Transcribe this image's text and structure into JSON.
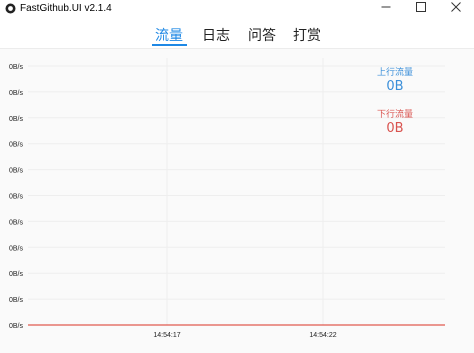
{
  "window": {
    "title": "FastGithub.UI v2.1.4"
  },
  "tabs": [
    {
      "label": "流量",
      "active": true
    },
    {
      "label": "日志",
      "active": false
    },
    {
      "label": "问答",
      "active": false
    },
    {
      "label": "打赏",
      "active": false
    }
  ],
  "stats": {
    "upload_label": "上行流量",
    "upload_value": "0B",
    "download_label": "下行流量",
    "download_value": "0B"
  },
  "colors": {
    "accent": "#1e88e5",
    "upload": "#3b8fd9",
    "download": "#d9534f"
  },
  "chart_data": {
    "type": "line",
    "y_tick_labels": [
      "0B/s",
      "0B/s",
      "0B/s",
      "0B/s",
      "0B/s",
      "0B/s",
      "0B/s",
      "0B/s",
      "0B/s",
      "0B/s",
      "0B/s"
    ],
    "x_tick_labels": [
      "14:54:17",
      "14:54:22"
    ],
    "series": [
      {
        "values": [
          0,
          0,
          0,
          0,
          0,
          0,
          0,
          0,
          0,
          0,
          0
        ],
        "color": "#e05a4f"
      }
    ],
    "grid": true
  }
}
